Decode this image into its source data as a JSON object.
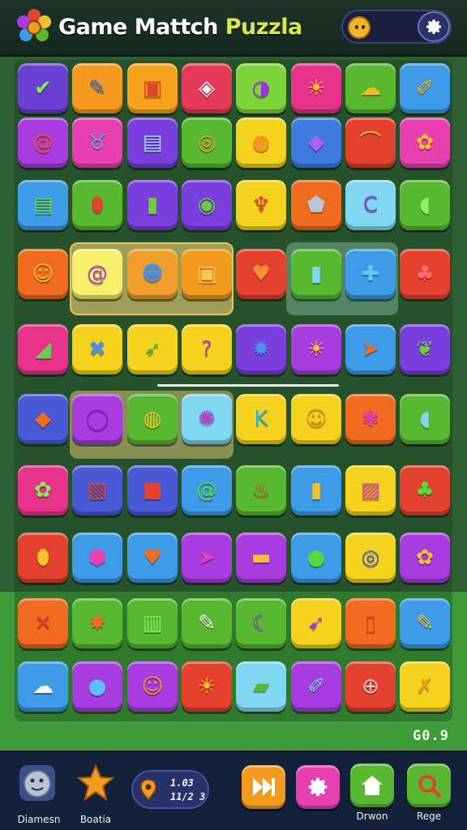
{
  "header": {
    "title_part1": "Game Mattch",
    "title_part2": "Puzzla",
    "colors": {
      "title_main": "#ffffff",
      "title_accent": "#d6e84a"
    }
  },
  "board": {
    "score": "G0.9",
    "rows": [
      [
        {
          "color": "#6a3fd1",
          "icon": "check-icon",
          "glyph": "✔",
          "fg": "#7df05a"
        },
        {
          "color": "#f59a1f",
          "icon": "pencil-icon",
          "glyph": "✎",
          "fg": "#2d6ad6"
        },
        {
          "color": "#f7a21c",
          "icon": "robot-icon",
          "glyph": "▣",
          "fg": "#e5412f"
        },
        {
          "color": "#e43b5b",
          "icon": "box-icon",
          "glyph": "◈",
          "fg": "#f4f4f4"
        },
        {
          "color": "#7cd33a",
          "icon": "moon-icon",
          "glyph": "◑",
          "fg": "#9b35e0"
        },
        {
          "color": "#e8338a",
          "icon": "sun-face-icon",
          "glyph": "☀",
          "fg": "#f6c12b"
        },
        {
          "color": "#58b930",
          "icon": "cloud-icon",
          "glyph": "☁",
          "fg": "#f3b92a"
        },
        {
          "color": "#3d9be8",
          "icon": "brush-icon",
          "glyph": "✐",
          "fg": "#f3b92a"
        }
      ],
      [
        {
          "color": "#a83ce0",
          "icon": "swirl-icon",
          "glyph": "@",
          "fg": "#f0503a"
        },
        {
          "color": "#e840b0",
          "icon": "cat-icon",
          "glyph": "♉",
          "fg": "#57a9f2"
        },
        {
          "color": "#7b3fe0",
          "icon": "radio-icon",
          "glyph": "▤",
          "fg": "#9fdbf5"
        },
        {
          "color": "#58b930",
          "icon": "donut-icon",
          "glyph": "◎",
          "fg": "#f09b3a"
        },
        {
          "color": "#f4d21e",
          "icon": "coin-icon",
          "glyph": "●",
          "fg": "#f29a1f"
        },
        {
          "color": "#3f7ae0",
          "icon": "gem-icon",
          "glyph": "◆",
          "fg": "#b05ef2"
        },
        {
          "color": "#e5412f",
          "icon": "rainbow-icon",
          "glyph": "⌒",
          "fg": "#f6c12b"
        },
        {
          "color": "#e840b0",
          "icon": "flower-icon",
          "glyph": "✿",
          "fg": "#f6c12b"
        }
      ],
      [
        {
          "color": "#3d9be8",
          "icon": "card-icon",
          "glyph": "▤",
          "fg": "#65d94a"
        },
        {
          "color": "#58b930",
          "icon": "mask-icon",
          "glyph": "⬮",
          "fg": "#e5412f"
        },
        {
          "color": "#7b3fe0",
          "icon": "bottle-icon",
          "glyph": "▮",
          "fg": "#6ccf3a"
        },
        {
          "color": "#7b3fe0",
          "icon": "ring-icon",
          "glyph": "◉",
          "fg": "#6ccf3a"
        },
        {
          "color": "#f4d21e",
          "icon": "tulip-icon",
          "glyph": "♆",
          "fg": "#e5412f"
        },
        {
          "color": "#f06a1f",
          "icon": "shield-icon",
          "glyph": "⬟",
          "fg": "#b9c6d8"
        },
        {
          "color": "#7fd7f2",
          "icon": "crescent-icon",
          "glyph": "C",
          "fg": "#8a3fe0"
        },
        {
          "color": "#58b930",
          "icon": "bulb-icon",
          "glyph": "◖",
          "fg": "#8df06a"
        }
      ],
      [
        {
          "color": "#f06a1f",
          "icon": "sun-face-icon",
          "glyph": "☺",
          "fg": "#f6c12b"
        },
        {
          "color": "#f7f06a",
          "icon": "swirl-icon",
          "glyph": "@",
          "fg": "#b03fd8"
        },
        {
          "color": "#f0a02a",
          "icon": "knight-icon",
          "glyph": "☻",
          "fg": "#4c8fe6"
        },
        {
          "color": "#f39b1f",
          "icon": "frame-icon",
          "glyph": "▣",
          "fg": "#f8c657"
        },
        {
          "color": "#e5412f",
          "icon": "heart-icon",
          "glyph": "♥",
          "fg": "#ff8a3a"
        },
        {
          "color": "#58b930",
          "icon": "lantern-icon",
          "glyph": "▮",
          "fg": "#7fd7f2"
        },
        {
          "color": "#3d9be8",
          "icon": "plus-icon",
          "glyph": "✚",
          "fg": "#66c7f4"
        },
        {
          "color": "#e5412f",
          "icon": "strawberry-icon",
          "glyph": "♣",
          "fg": "#ff6a6a"
        }
      ],
      [
        {
          "color": "#e8338a",
          "icon": "tag-icon",
          "glyph": "◢",
          "fg": "#5fd34a"
        },
        {
          "color": "#f4d21e",
          "icon": "cross-icon",
          "glyph": "✖",
          "fg": "#4c8fe6"
        },
        {
          "color": "#f4d21e",
          "icon": "rocket-icon",
          "glyph": "➶",
          "fg": "#58b930"
        },
        {
          "color": "#f4d21e",
          "icon": "question-icon",
          "glyph": "?",
          "fg": "#b03fd8"
        },
        {
          "color": "#7b3fe0",
          "icon": "gear-icon",
          "glyph": "✹",
          "fg": "#4c8fe6"
        },
        {
          "color": "#a83ce0",
          "icon": "sun-icon",
          "glyph": "☀",
          "fg": "#f6c12b"
        },
        {
          "color": "#3d9be8",
          "icon": "plane-icon",
          "glyph": "➤",
          "fg": "#f06a1f"
        },
        {
          "color": "#7b3fe0",
          "icon": "leaf-icon",
          "glyph": "❦",
          "fg": "#6ccf3a"
        }
      ],
      [
        {
          "color": "#4a5ad6",
          "icon": "diamond-icon",
          "glyph": "◆",
          "fg": "#f06a1f"
        },
        {
          "color": "#a83ce0",
          "icon": "ring-icon",
          "glyph": "◯",
          "fg": "#7a2ad0"
        },
        {
          "color": "#58b930",
          "icon": "acorn-icon",
          "glyph": "◍",
          "fg": "#f6c12b"
        },
        {
          "color": "#7fd7f2",
          "icon": "candy-icon",
          "glyph": "✺",
          "fg": "#c23ad2"
        },
        {
          "color": "#f4d21e",
          "icon": "letter-k-icon",
          "glyph": "K",
          "fg": "#2bb3c9"
        },
        {
          "color": "#f4d21e",
          "icon": "sun-face-icon",
          "glyph": "☺",
          "fg": "#f29a1f"
        },
        {
          "color": "#f06a1f",
          "icon": "flower-icon",
          "glyph": "✾",
          "fg": "#e840b0"
        },
        {
          "color": "#58b930",
          "icon": "bulb-icon",
          "glyph": "◖",
          "fg": "#7fd7f2"
        }
      ],
      [
        {
          "color": "#e8338a",
          "icon": "flower-icon",
          "glyph": "✿",
          "fg": "#7df05a"
        },
        {
          "color": "#4a5ad6",
          "icon": "card-icon",
          "glyph": "▧",
          "fg": "#e5412f"
        },
        {
          "color": "#4a5ad6",
          "icon": "box-icon",
          "glyph": "■",
          "fg": "#e5412f"
        },
        {
          "color": "#3d9be8",
          "icon": "spiral-icon",
          "glyph": "@",
          "fg": "#58d93a"
        },
        {
          "color": "#58b930",
          "icon": "flame-icon",
          "glyph": "♨",
          "fg": "#e5412f"
        },
        {
          "color": "#3d9be8",
          "icon": "battery-icon",
          "glyph": "▮",
          "fg": "#f6c12b"
        },
        {
          "color": "#f4d21e",
          "icon": "picture-icon",
          "glyph": "▨",
          "fg": "#e840b0"
        },
        {
          "color": "#e5412f",
          "icon": "plant-icon",
          "glyph": "♣",
          "fg": "#58d93a"
        }
      ],
      [
        {
          "color": "#e5412f",
          "icon": "pin-icon",
          "glyph": "⬮",
          "fg": "#f6c12b"
        },
        {
          "color": "#3d9be8",
          "icon": "cube-icon",
          "glyph": "⬢",
          "fg": "#e840b0"
        },
        {
          "color": "#3d9be8",
          "icon": "heart-icon",
          "glyph": "♥",
          "fg": "#f06a1f"
        },
        {
          "color": "#a83ce0",
          "icon": "plane-icon",
          "glyph": "➤",
          "fg": "#e840b0"
        },
        {
          "color": "#a83ce0",
          "icon": "tube-icon",
          "glyph": "▬",
          "fg": "#f6c12b"
        },
        {
          "color": "#3d9be8",
          "icon": "chat-icon",
          "glyph": "●",
          "fg": "#58d93a"
        },
        {
          "color": "#f4d21e",
          "icon": "ring-icon",
          "glyph": "◎",
          "fg": "#3d5ad6"
        },
        {
          "color": "#a83ce0",
          "icon": "flower-icon",
          "glyph": "✿",
          "fg": "#f6c12b"
        }
      ],
      [
        {
          "color": "#f06a1f",
          "icon": "cross-icon",
          "glyph": "✕",
          "fg": "#e5412f"
        },
        {
          "color": "#58b930",
          "icon": "star-icon",
          "glyph": "✸",
          "fg": "#f06a1f"
        },
        {
          "color": "#58b930",
          "icon": "trash-icon",
          "glyph": "▥",
          "fg": "#7df05a"
        },
        {
          "color": "#58b930",
          "icon": "pen-icon",
          "glyph": "✎",
          "fg": "#f4f4f4"
        },
        {
          "color": "#58b930",
          "icon": "moon-icon",
          "glyph": "☾",
          "fg": "#8a3fe0"
        },
        {
          "color": "#f4d21e",
          "icon": "bolt-icon",
          "glyph": "➹",
          "fg": "#a83ce0"
        },
        {
          "color": "#f06a1f",
          "icon": "frame-icon",
          "glyph": "▯",
          "fg": "#e5412f"
        },
        {
          "color": "#3d9be8",
          "icon": "pencil-icon",
          "glyph": "✎",
          "fg": "#f6c12b"
        }
      ],
      [
        {
          "color": "#3d9be8",
          "icon": "cloud-icon",
          "glyph": "☁",
          "fg": "#f4f4f4"
        },
        {
          "color": "#a83ce0",
          "icon": "orb-icon",
          "glyph": "●",
          "fg": "#57c3f4"
        },
        {
          "color": "#a83ce0",
          "icon": "face-icon",
          "glyph": "☺",
          "fg": "#f29a1f"
        },
        {
          "color": "#e5412f",
          "icon": "sun-face-icon",
          "glyph": "☀",
          "fg": "#f6c12b"
        },
        {
          "color": "#7fd7f2",
          "icon": "stick-icon",
          "glyph": "▰",
          "fg": "#58b930"
        },
        {
          "color": "#a83ce0",
          "icon": "brush-icon",
          "glyph": "✐",
          "fg": "#7fd7f2"
        },
        {
          "color": "#e5412f",
          "icon": "balloon-icon",
          "glyph": "⊕",
          "fg": "#f4c6c6"
        },
        {
          "color": "#f4d21e",
          "icon": "x-icon",
          "glyph": "✗",
          "fg": "#f29a1f"
        }
      ]
    ]
  },
  "bottom_bar": {
    "left_item_1": {
      "label": "Diamesn",
      "icon": "moon-face-icon"
    },
    "left_item_2": {
      "label": "Boatia",
      "icon": "star-icon"
    },
    "info": {
      "icon": "pin-icon",
      "line1": "1.03",
      "line2": "11/2 3"
    },
    "btn_play": {
      "icon": "fast-forward-icon",
      "color": "#f39b1f"
    },
    "btn_settings": {
      "icon": "gear-icon",
      "color": "#e840b0"
    },
    "btn_home": {
      "label": "Drwon",
      "icon": "home-icon",
      "color": "#58b930"
    },
    "btn_search": {
      "label": "Rege",
      "icon": "search-icon",
      "color": "#58b930"
    }
  }
}
